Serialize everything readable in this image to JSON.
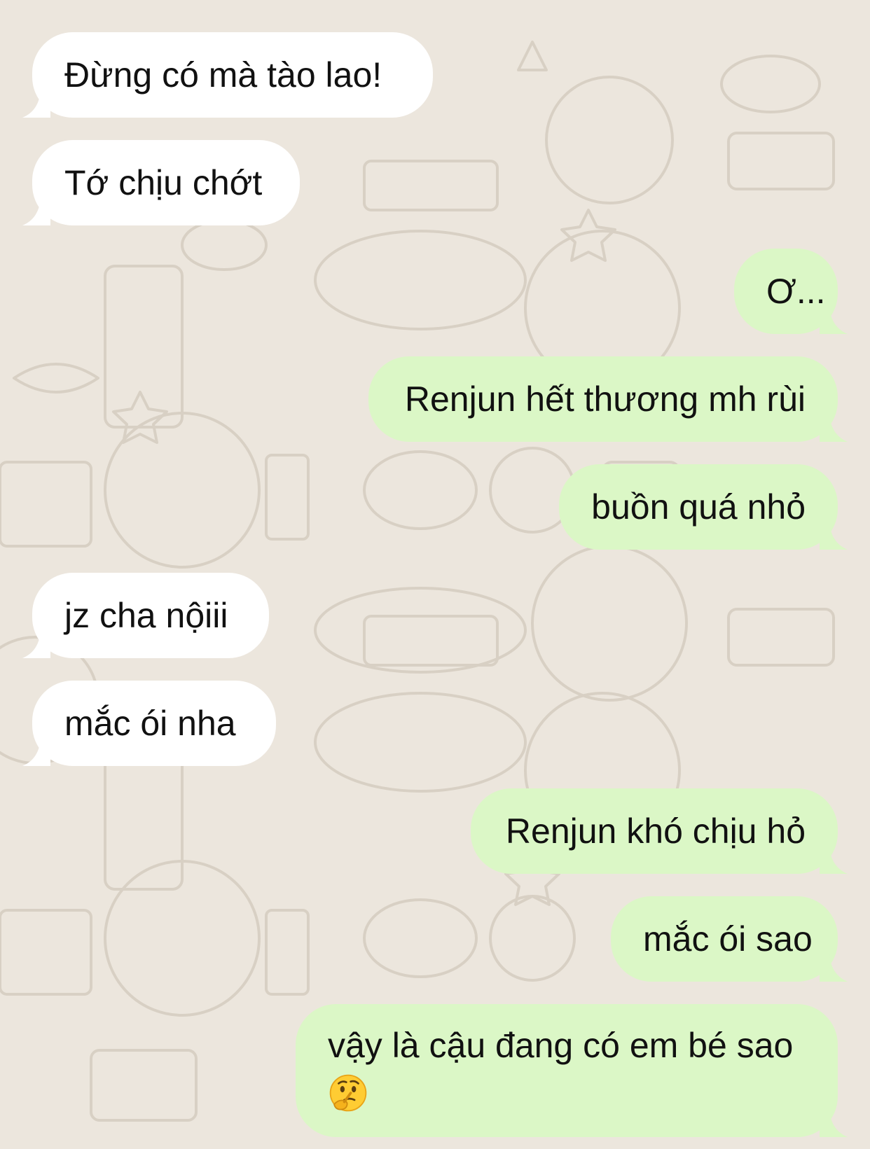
{
  "conversation": {
    "messages": [
      {
        "direction": "incoming",
        "text": "Đừng có mà tào lao!"
      },
      {
        "direction": "incoming",
        "text": "Tớ chịu chớt"
      },
      {
        "direction": "outgoing",
        "text": "Ơ..."
      },
      {
        "direction": "outgoing",
        "text": "Renjun hết thương mh rùi"
      },
      {
        "direction": "outgoing",
        "text": "buồn quá nhỏ"
      },
      {
        "direction": "incoming",
        "text": "jz cha nộiii"
      },
      {
        "direction": "incoming",
        "text": "mắc ói nha"
      },
      {
        "direction": "outgoing",
        "text": "Renjun khó chịu hỏ"
      },
      {
        "direction": "outgoing",
        "text": "mắc ói sao"
      },
      {
        "direction": "outgoing",
        "text": "vậy là cậu đang có em bé sao",
        "emoji": "thinking-face-emoji"
      }
    ]
  },
  "colors": {
    "background": "#ece6dd",
    "incoming_bubble": "#ffffff",
    "outgoing_bubble": "#dbf7c6",
    "text": "#111111"
  }
}
